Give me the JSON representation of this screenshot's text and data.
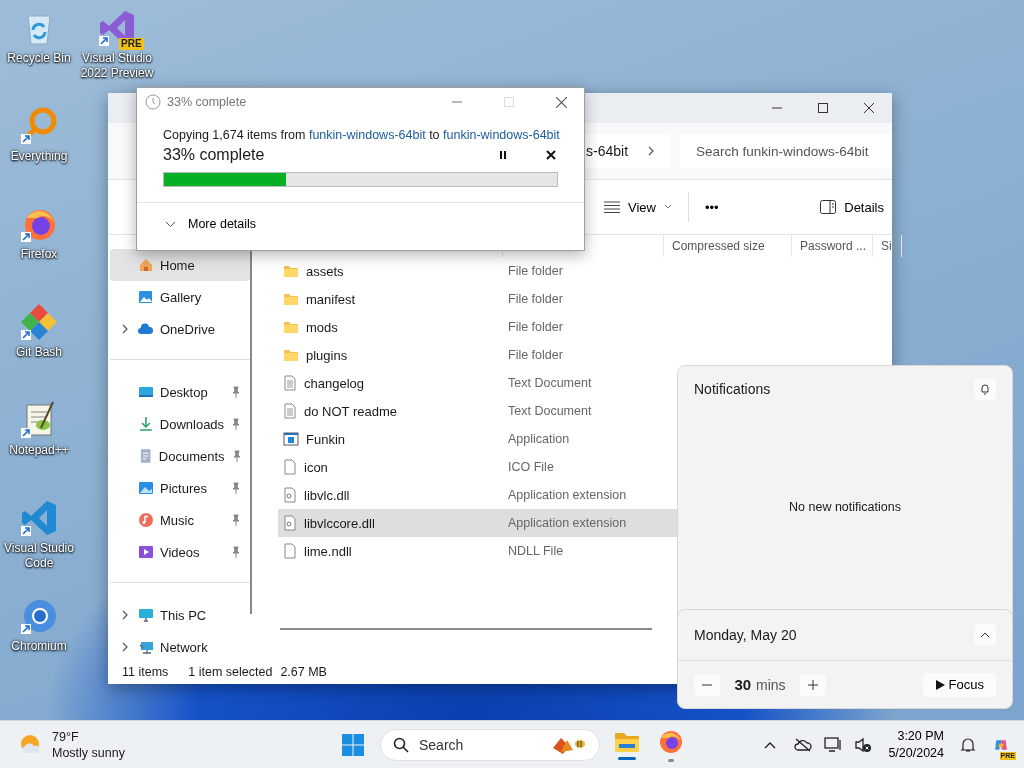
{
  "desktop_icons": [
    {
      "label": "Recycle Bin",
      "kind": "recycle"
    },
    {
      "label": "Everything",
      "kind": "everything"
    },
    {
      "label": "Firefox",
      "kind": "firefox"
    },
    {
      "label": "Git Bash",
      "kind": "gitbash"
    },
    {
      "label": "Notepad++",
      "kind": "notepad"
    },
    {
      "label": "Visual Studio Code",
      "kind": "vscode"
    },
    {
      "label": "Chromium",
      "kind": "chromium"
    },
    {
      "label": "Visual Studio 2022 Preview",
      "kind": "vs",
      "badge": "PRE"
    }
  ],
  "explorer": {
    "breadcrumb": "s-64bit",
    "search": {
      "placeholder": "Search funkin-windows-64bit"
    },
    "toolbar": {
      "view": "View",
      "more": "•••",
      "details": "Details"
    },
    "columns": [
      "Compressed size",
      "Password ...",
      "Si"
    ],
    "nav_sections": [
      {
        "items": [
          {
            "label": "Home",
            "kind": "home",
            "selected": true,
            "pinned": false,
            "expandable": false
          },
          {
            "label": "Gallery",
            "kind": "gallery",
            "selected": false,
            "pinned": false,
            "expandable": false
          },
          {
            "label": "OneDrive",
            "kind": "onedrive",
            "selected": false,
            "pinned": false,
            "expandable": true
          }
        ]
      },
      {
        "items": [
          {
            "label": "Desktop",
            "kind": "desktop",
            "selected": false,
            "pinned": true,
            "expandable": false
          },
          {
            "label": "Downloads",
            "kind": "downloads",
            "selected": false,
            "pinned": true,
            "expandable": false
          },
          {
            "label": "Documents",
            "kind": "documents",
            "selected": false,
            "pinned": true,
            "expandable": false
          },
          {
            "label": "Pictures",
            "kind": "pictures",
            "selected": false,
            "pinned": true,
            "expandable": false
          },
          {
            "label": "Music",
            "kind": "music",
            "selected": false,
            "pinned": true,
            "expandable": false
          },
          {
            "label": "Videos",
            "kind": "videos",
            "selected": false,
            "pinned": true,
            "expandable": false
          }
        ]
      },
      {
        "items": [
          {
            "label": "This PC",
            "kind": "thispc",
            "selected": false,
            "pinned": false,
            "expandable": true
          },
          {
            "label": "Network",
            "kind": "network",
            "selected": false,
            "pinned": false,
            "expandable": true
          }
        ]
      }
    ],
    "files": [
      {
        "name": "assets",
        "type": "File folder",
        "kind": "folder",
        "selected": false
      },
      {
        "name": "manifest",
        "type": "File folder",
        "kind": "folder",
        "selected": false
      },
      {
        "name": "mods",
        "type": "File folder",
        "kind": "folder",
        "selected": false
      },
      {
        "name": "plugins",
        "type": "File folder",
        "kind": "folder",
        "selected": false
      },
      {
        "name": "changelog",
        "type": "Text Document",
        "kind": "text",
        "selected": false
      },
      {
        "name": "do NOT readme",
        "type": "Text Document",
        "kind": "text",
        "selected": false
      },
      {
        "name": "Funkin",
        "type": "Application",
        "kind": "app",
        "selected": false
      },
      {
        "name": "icon",
        "type": "ICO File",
        "kind": "file",
        "selected": false
      },
      {
        "name": "libvlc.dll",
        "type": "Application extension",
        "kind": "dll",
        "selected": false
      },
      {
        "name": "libvlccore.dll",
        "type": "Application extension",
        "kind": "dll",
        "selected": true
      },
      {
        "name": "lime.ndll",
        "type": "NDLL File",
        "kind": "file",
        "selected": false
      }
    ],
    "status": {
      "count": "11 items",
      "selection": "1 item selected",
      "size": "2.67 MB"
    }
  },
  "copy_dialog": {
    "title": "33% complete",
    "message_prefix": "Copying 1,674 items from",
    "source": "funkin-windows-64bit",
    "message_middle": "to",
    "destination": "funkin-windows-64bit",
    "heading": "33% complete",
    "level": 0.31,
    "more": "More details"
  },
  "notifications": {
    "title": "Notifications",
    "empty": "No new notifications"
  },
  "calendar": {
    "date": "Monday, May 20",
    "minutes": "30",
    "unit": "mins",
    "focus": "Focus"
  },
  "taskbar": {
    "weather": {
      "temp": "79°F",
      "condition": "Mostly sunny"
    },
    "search": {
      "placeholder": "Search"
    },
    "apps": [
      {
        "kind": "explorer",
        "active": true
      },
      {
        "kind": "firefox",
        "active": false
      }
    ],
    "time": "3:20 PM",
    "date": "5/20/2024",
    "copilot_badge": "PRE"
  }
}
